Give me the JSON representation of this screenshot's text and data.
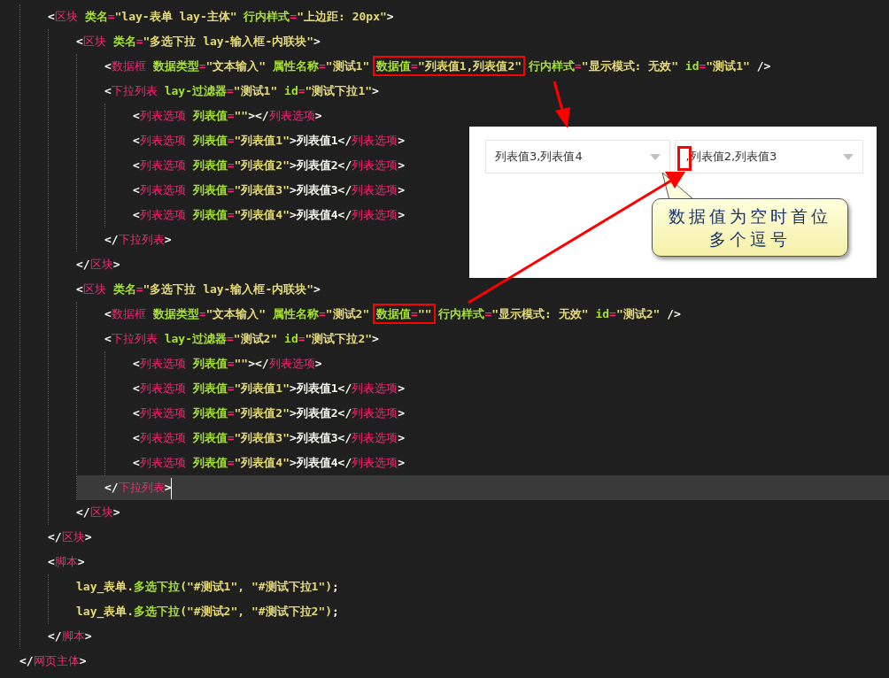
{
  "editor": {
    "lines": [
      {
        "children": [
          {
            "current": false,
            "tokens": [
              {
                "kind": "punct",
                "text": "<"
              },
              {
                "kind": "tag",
                "text": "区块"
              },
              {
                "kind": "attr",
                "text": " 类名"
              },
              {
                "kind": "eq",
                "text": "="
              },
              {
                "kind": "str",
                "text": "\"lay-表单 lay-主体\""
              },
              {
                "kind": "attr",
                "text": " 行内样式"
              },
              {
                "kind": "eq",
                "text": "="
              },
              {
                "kind": "str",
                "text": "\"上边距: 20px\""
              },
              {
                "kind": "punct",
                "text": ">"
              }
            ],
            "children": [
              {
                "current": false,
                "tokens": [
                  {
                    "kind": "punct",
                    "text": "<"
                  },
                  {
                    "kind": "tag",
                    "text": "区块"
                  },
                  {
                    "kind": "attr",
                    "text": " 类名"
                  },
                  {
                    "kind": "eq",
                    "text": "="
                  },
                  {
                    "kind": "str",
                    "text": "\"多选下拉 lay-输入框-内联块\""
                  },
                  {
                    "kind": "punct",
                    "text": ">"
                  }
                ],
                "children": [
                  {
                    "current": false,
                    "tokens": [
                      {
                        "kind": "punct",
                        "text": "<"
                      },
                      {
                        "kind": "tag",
                        "text": "数据框"
                      },
                      {
                        "kind": "attr",
                        "text": " 数据类型"
                      },
                      {
                        "kind": "eq",
                        "text": "="
                      },
                      {
                        "kind": "str",
                        "text": "\"文本输入\""
                      },
                      {
                        "kind": "attr",
                        "text": " 属性名称"
                      },
                      {
                        "kind": "eq",
                        "text": "="
                      },
                      {
                        "kind": "str",
                        "text": "\"测试1\" "
                      },
                      {
                        "kind": "box",
                        "tokens": [
                          {
                            "kind": "attr",
                            "text": "数据值"
                          },
                          {
                            "kind": "eq",
                            "text": "="
                          },
                          {
                            "kind": "str",
                            "text": "\"列表值1,列表值2\""
                          }
                        ]
                      },
                      {
                        "kind": "attr",
                        "text": " 行内样式"
                      },
                      {
                        "kind": "eq",
                        "text": "="
                      },
                      {
                        "kind": "str",
                        "text": "\"显示模式: 无效\""
                      },
                      {
                        "kind": "attr",
                        "text": " id"
                      },
                      {
                        "kind": "eq",
                        "text": "="
                      },
                      {
                        "kind": "str",
                        "text": "\"测试1\""
                      },
                      {
                        "kind": "punct",
                        "text": " />"
                      }
                    ]
                  },
                  {
                    "current": false,
                    "tokens": [
                      {
                        "kind": "punct",
                        "text": "<"
                      },
                      {
                        "kind": "tag",
                        "text": "下拉列表"
                      },
                      {
                        "kind": "attr",
                        "text": " lay-过滤器"
                      },
                      {
                        "kind": "eq",
                        "text": "="
                      },
                      {
                        "kind": "str",
                        "text": "\"测试1\""
                      },
                      {
                        "kind": "attr",
                        "text": " id"
                      },
                      {
                        "kind": "eq",
                        "text": "="
                      },
                      {
                        "kind": "str",
                        "text": "\"测试下拉1\""
                      },
                      {
                        "kind": "punct",
                        "text": ">"
                      }
                    ],
                    "children": [
                      {
                        "current": false,
                        "tokens": [
                          {
                            "kind": "punct",
                            "text": "<"
                          },
                          {
                            "kind": "tag",
                            "text": "列表选项"
                          },
                          {
                            "kind": "attr",
                            "text": " 列表值"
                          },
                          {
                            "kind": "eq",
                            "text": "="
                          },
                          {
                            "kind": "str",
                            "text": "\"\""
                          },
                          {
                            "kind": "punct",
                            "text": "></"
                          },
                          {
                            "kind": "tag",
                            "text": "列表选项"
                          },
                          {
                            "kind": "punct",
                            "text": ">"
                          }
                        ]
                      },
                      {
                        "current": false,
                        "tokens": [
                          {
                            "kind": "punct",
                            "text": "<"
                          },
                          {
                            "kind": "tag",
                            "text": "列表选项"
                          },
                          {
                            "kind": "attr",
                            "text": " 列表值"
                          },
                          {
                            "kind": "eq",
                            "text": "="
                          },
                          {
                            "kind": "str",
                            "text": "\"列表值1\""
                          },
                          {
                            "kind": "punct",
                            "text": ">列表值1</"
                          },
                          {
                            "kind": "tag",
                            "text": "列表选项"
                          },
                          {
                            "kind": "punct",
                            "text": ">"
                          }
                        ]
                      },
                      {
                        "current": false,
                        "tokens": [
                          {
                            "kind": "punct",
                            "text": "<"
                          },
                          {
                            "kind": "tag",
                            "text": "列表选项"
                          },
                          {
                            "kind": "attr",
                            "text": " 列表值"
                          },
                          {
                            "kind": "eq",
                            "text": "="
                          },
                          {
                            "kind": "str",
                            "text": "\"列表值2\""
                          },
                          {
                            "kind": "punct",
                            "text": ">列表值2</"
                          },
                          {
                            "kind": "tag",
                            "text": "列表选项"
                          },
                          {
                            "kind": "punct",
                            "text": ">"
                          }
                        ]
                      },
                      {
                        "current": false,
                        "tokens": [
                          {
                            "kind": "punct",
                            "text": "<"
                          },
                          {
                            "kind": "tag",
                            "text": "列表选项"
                          },
                          {
                            "kind": "attr",
                            "text": " 列表值"
                          },
                          {
                            "kind": "eq",
                            "text": "="
                          },
                          {
                            "kind": "str",
                            "text": "\"列表值3\""
                          },
                          {
                            "kind": "punct",
                            "text": ">列表值3</"
                          },
                          {
                            "kind": "tag",
                            "text": "列表选项"
                          },
                          {
                            "kind": "punct",
                            "text": ">"
                          }
                        ]
                      },
                      {
                        "current": false,
                        "tokens": [
                          {
                            "kind": "punct",
                            "text": "<"
                          },
                          {
                            "kind": "tag",
                            "text": "列表选项"
                          },
                          {
                            "kind": "attr",
                            "text": " 列表值"
                          },
                          {
                            "kind": "eq",
                            "text": "="
                          },
                          {
                            "kind": "str",
                            "text": "\"列表值4\""
                          },
                          {
                            "kind": "punct",
                            "text": ">列表值4</"
                          },
                          {
                            "kind": "tag",
                            "text": "列表选项"
                          },
                          {
                            "kind": "punct",
                            "text": ">"
                          }
                        ]
                      }
                    ]
                  },
                  {
                    "current": false,
                    "tokens": [
                      {
                        "kind": "punct",
                        "text": "</"
                      },
                      {
                        "kind": "tag",
                        "text": "下拉列表"
                      },
                      {
                        "kind": "punct",
                        "text": ">"
                      }
                    ]
                  }
                ]
              },
              {
                "current": false,
                "tokens": [
                  {
                    "kind": "punct",
                    "text": "</"
                  },
                  {
                    "kind": "tag",
                    "text": "区块"
                  },
                  {
                    "kind": "punct",
                    "text": ">"
                  }
                ]
              },
              {
                "current": false,
                "tokens": [
                  {
                    "kind": "punct",
                    "text": "<"
                  },
                  {
                    "kind": "tag",
                    "text": "区块"
                  },
                  {
                    "kind": "attr",
                    "text": " 类名"
                  },
                  {
                    "kind": "eq",
                    "text": "="
                  },
                  {
                    "kind": "str",
                    "text": "\"多选下拉 lay-输入框-内联块\""
                  },
                  {
                    "kind": "punct",
                    "text": ">"
                  }
                ],
                "children": [
                  {
                    "current": false,
                    "tokens": [
                      {
                        "kind": "punct",
                        "text": "<"
                      },
                      {
                        "kind": "tag",
                        "text": "数据框"
                      },
                      {
                        "kind": "attr",
                        "text": " 数据类型"
                      },
                      {
                        "kind": "eq",
                        "text": "="
                      },
                      {
                        "kind": "str",
                        "text": "\"文本输入\""
                      },
                      {
                        "kind": "attr",
                        "text": " 属性名称"
                      },
                      {
                        "kind": "eq",
                        "text": "="
                      },
                      {
                        "kind": "str",
                        "text": "\"测试2\" "
                      },
                      {
                        "kind": "box",
                        "tokens": [
                          {
                            "kind": "attr",
                            "text": "数据值"
                          },
                          {
                            "kind": "eq",
                            "text": "="
                          },
                          {
                            "kind": "str",
                            "text": "\"\""
                          }
                        ]
                      },
                      {
                        "kind": "attr",
                        "text": " 行内样式"
                      },
                      {
                        "kind": "eq",
                        "text": "="
                      },
                      {
                        "kind": "str",
                        "text": "\"显示模式: 无效\""
                      },
                      {
                        "kind": "attr",
                        "text": " id"
                      },
                      {
                        "kind": "eq",
                        "text": "="
                      },
                      {
                        "kind": "str",
                        "text": "\"测试2\""
                      },
                      {
                        "kind": "punct",
                        "text": " />"
                      }
                    ]
                  },
                  {
                    "current": false,
                    "tokens": [
                      {
                        "kind": "punct",
                        "text": "<"
                      },
                      {
                        "kind": "tag",
                        "text": "下拉列表"
                      },
                      {
                        "kind": "attr",
                        "text": " lay-过滤器"
                      },
                      {
                        "kind": "eq",
                        "text": "="
                      },
                      {
                        "kind": "str",
                        "text": "\"测试2\""
                      },
                      {
                        "kind": "attr",
                        "text": " id"
                      },
                      {
                        "kind": "eq",
                        "text": "="
                      },
                      {
                        "kind": "str",
                        "text": "\"测试下拉2\""
                      },
                      {
                        "kind": "punct",
                        "text": ">"
                      }
                    ],
                    "children": [
                      {
                        "current": false,
                        "tokens": [
                          {
                            "kind": "punct",
                            "text": "<"
                          },
                          {
                            "kind": "tag",
                            "text": "列表选项"
                          },
                          {
                            "kind": "attr",
                            "text": " 列表值"
                          },
                          {
                            "kind": "eq",
                            "text": "="
                          },
                          {
                            "kind": "str",
                            "text": "\"\""
                          },
                          {
                            "kind": "punct",
                            "text": "></"
                          },
                          {
                            "kind": "tag",
                            "text": "列表选项"
                          },
                          {
                            "kind": "punct",
                            "text": ">"
                          }
                        ]
                      },
                      {
                        "current": false,
                        "tokens": [
                          {
                            "kind": "punct",
                            "text": "<"
                          },
                          {
                            "kind": "tag",
                            "text": "列表选项"
                          },
                          {
                            "kind": "attr",
                            "text": " 列表值"
                          },
                          {
                            "kind": "eq",
                            "text": "="
                          },
                          {
                            "kind": "str",
                            "text": "\"列表值1\""
                          },
                          {
                            "kind": "punct",
                            "text": ">列表值1</"
                          },
                          {
                            "kind": "tag",
                            "text": "列表选项"
                          },
                          {
                            "kind": "punct",
                            "text": ">"
                          }
                        ]
                      },
                      {
                        "current": false,
                        "tokens": [
                          {
                            "kind": "punct",
                            "text": "<"
                          },
                          {
                            "kind": "tag",
                            "text": "列表选项"
                          },
                          {
                            "kind": "attr",
                            "text": " 列表值"
                          },
                          {
                            "kind": "eq",
                            "text": "="
                          },
                          {
                            "kind": "str",
                            "text": "\"列表值2\""
                          },
                          {
                            "kind": "punct",
                            "text": ">列表值2</"
                          },
                          {
                            "kind": "tag",
                            "text": "列表选项"
                          },
                          {
                            "kind": "punct",
                            "text": ">"
                          }
                        ]
                      },
                      {
                        "current": false,
                        "tokens": [
                          {
                            "kind": "punct",
                            "text": "<"
                          },
                          {
                            "kind": "tag",
                            "text": "列表选项"
                          },
                          {
                            "kind": "attr",
                            "text": " 列表值"
                          },
                          {
                            "kind": "eq",
                            "text": "="
                          },
                          {
                            "kind": "str",
                            "text": "\"列表值3\""
                          },
                          {
                            "kind": "punct",
                            "text": ">列表值3</"
                          },
                          {
                            "kind": "tag",
                            "text": "列表选项"
                          },
                          {
                            "kind": "punct",
                            "text": ">"
                          }
                        ]
                      },
                      {
                        "current": false,
                        "tokens": [
                          {
                            "kind": "punct",
                            "text": "<"
                          },
                          {
                            "kind": "tag",
                            "text": "列表选项"
                          },
                          {
                            "kind": "attr",
                            "text": " 列表值"
                          },
                          {
                            "kind": "eq",
                            "text": "="
                          },
                          {
                            "kind": "str",
                            "text": "\"列表值4\""
                          },
                          {
                            "kind": "punct",
                            "text": ">列表值4</"
                          },
                          {
                            "kind": "tag",
                            "text": "列表选项"
                          },
                          {
                            "kind": "punct",
                            "text": ">"
                          }
                        ]
                      }
                    ]
                  },
                  {
                    "current": true,
                    "tokens": [
                      {
                        "kind": "punct",
                        "text": "</"
                      },
                      {
                        "kind": "tag",
                        "text": "下拉列表"
                      },
                      {
                        "kind": "punct",
                        "text": ">"
                      }
                    ]
                  }
                ]
              },
              {
                "current": false,
                "tokens": [
                  {
                    "kind": "punct",
                    "text": "</"
                  },
                  {
                    "kind": "tag",
                    "text": "区块"
                  },
                  {
                    "kind": "punct",
                    "text": ">"
                  }
                ]
              }
            ]
          },
          {
            "current": false,
            "tokens": [
              {
                "kind": "punct",
                "text": "</"
              },
              {
                "kind": "tag",
                "text": "区块"
              },
              {
                "kind": "punct",
                "text": ">"
              }
            ]
          },
          {
            "current": false,
            "tokens": [
              {
                "kind": "punct",
                "text": "<"
              },
              {
                "kind": "tag",
                "text": "脚本"
              },
              {
                "kind": "punct",
                "text": ">"
              }
            ],
            "children": [
              {
                "current": false,
                "tokens": [
                  {
                    "kind": "obj",
                    "text": "lay_表单."
                  },
                  {
                    "kind": "fn",
                    "text": "多选下拉"
                  },
                  {
                    "kind": "str",
                    "text": "(\"#测试1\", \"#测试下拉1\")"
                  },
                  {
                    "kind": "punct",
                    "text": ";"
                  }
                ]
              },
              {
                "current": false,
                "tokens": [
                  {
                    "kind": "obj",
                    "text": "lay_表单."
                  },
                  {
                    "kind": "fn",
                    "text": "多选下拉"
                  },
                  {
                    "kind": "str",
                    "text": "(\"#测试2\", \"#测试下拉2\")"
                  },
                  {
                    "kind": "punct",
                    "text": ";"
                  }
                ]
              }
            ]
          },
          {
            "current": false,
            "tokens": [
              {
                "kind": "punct",
                "text": "</"
              },
              {
                "kind": "tag",
                "text": "脚本"
              },
              {
                "kind": "punct",
                "text": ">"
              }
            ]
          }
        ]
      },
      {
        "current": false,
        "tokens": [
          {
            "kind": "punct",
            "text": "</"
          },
          {
            "kind": "tag",
            "text": "网页主体"
          },
          {
            "kind": "punct",
            "text": ">"
          }
        ]
      }
    ]
  },
  "preview": {
    "selects": [
      {
        "value": "列表值3,列表值4",
        "boxed": false
      },
      {
        "value": ",列表值2,列表值3",
        "boxed": true
      }
    ],
    "callout": "数据值为空时首位多个逗号"
  }
}
